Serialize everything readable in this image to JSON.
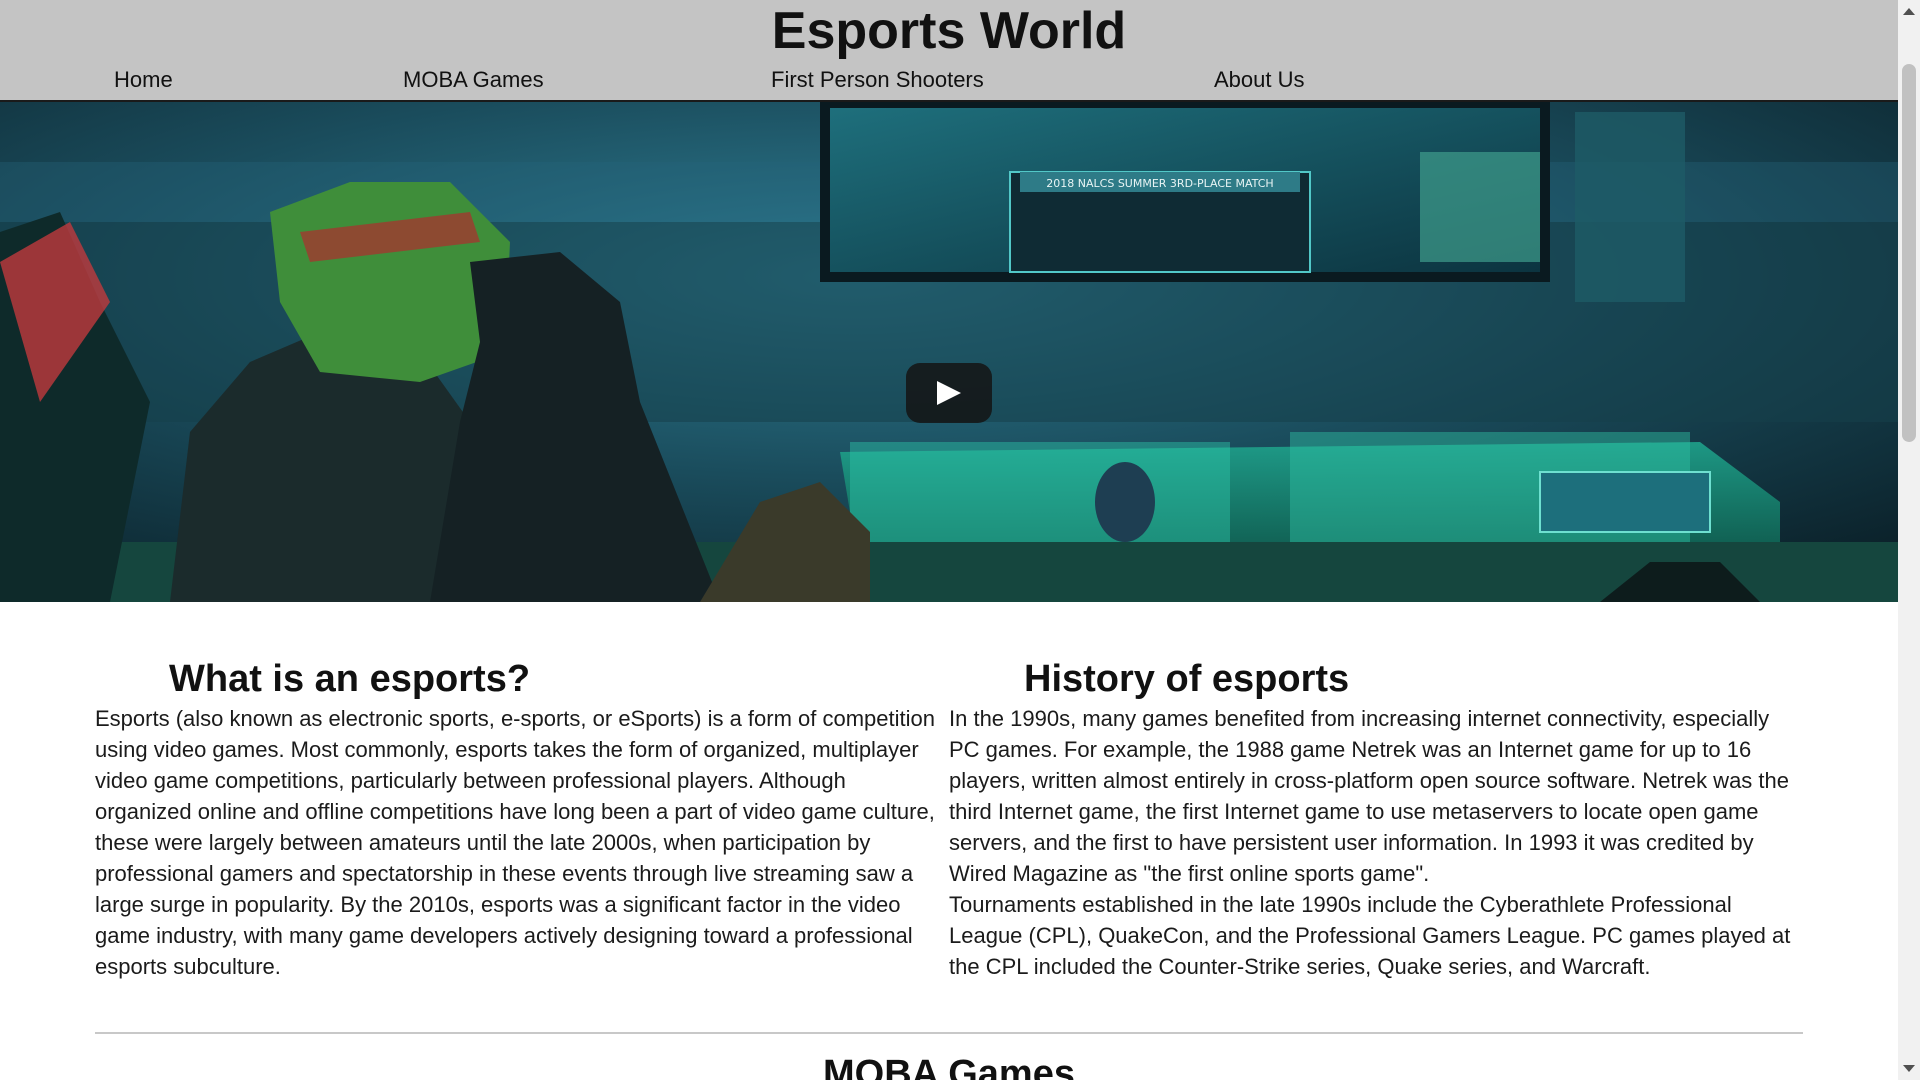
{
  "header": {
    "title": "Esports World",
    "nav": [
      {
        "label": "Home"
      },
      {
        "label": "MOBA Games"
      },
      {
        "label": "First Person Shooters"
      },
      {
        "label": "About Us"
      }
    ]
  },
  "hero": {
    "play_icon": "play-icon",
    "arena_banner": "2018 NALCS SUMMER 3RD-PLACE MATCH"
  },
  "main": {
    "sections": [
      {
        "heading": "What is an esports?",
        "paragraphs": [
          "Esports (also known as electronic sports, e-sports, or eSports) is a form of competition using video games. Most commonly, esports takes the form of organized, multiplayer video game competitions, particularly between professional players. Although organized online and offline competitions have long been a part of video game culture, these were largely between amateurs until the late 2000s, when participation by professional gamers and spectatorship in these events through live streaming saw a large surge in popularity. By the 2010s, esports was a significant factor in the video game industry, with many game developers actively designing toward a professional esports subculture."
        ]
      },
      {
        "heading": "History of esports",
        "paragraphs": [
          "In the 1990s, many games benefited from increasing internet connectivity, especially PC games. For example, the 1988 game Netrek was an Internet game for up to 16 players, written almost entirely in cross-platform open source software. Netrek was the third Internet game, the first Internet game to use metaservers to locate open game servers, and the first to have persistent user information. In 1993 it was credited by Wired Magazine as \"the first online sports game\".",
          "Tournaments established in the late 1990s include the Cyberathlete Professional League (CPL), QuakeCon, and the Professional Gamers League. PC games played at the CPL included the Counter-Strike series, Quake series, and Warcraft."
        ]
      }
    ],
    "next_section_heading": "MOBA Games"
  },
  "colors": {
    "header_bg": "#c4c4c4",
    "page_bg": "#ffffff",
    "text": "#111111"
  }
}
